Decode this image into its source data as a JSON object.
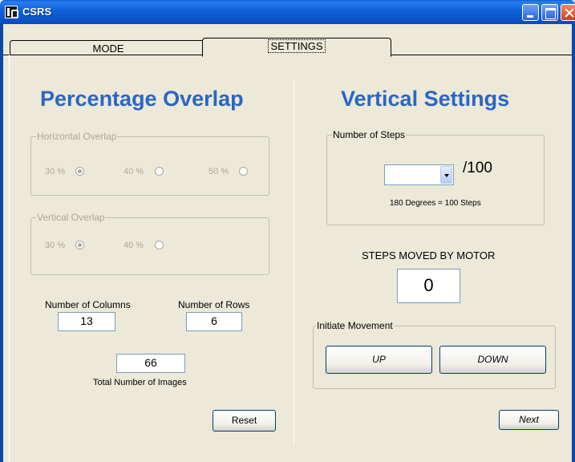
{
  "window": {
    "title": "CSRS"
  },
  "tabs": [
    {
      "label": "MODE"
    },
    {
      "label": "SETTINGS"
    }
  ],
  "overlap": {
    "heading": "Percentage Overlap",
    "horizontal": {
      "title": "Horizontal Overlap",
      "options": [
        "30 %",
        "40 %",
        "50 %"
      ],
      "selected": "30 %"
    },
    "vertical": {
      "title": "Vertical Overlap",
      "options": [
        "30 %",
        "40 %"
      ],
      "selected": "30 %"
    },
    "columns_label": "Number of Columns",
    "columns_value": "13",
    "rows_label": "Number of Rows",
    "rows_value": "6",
    "total_value": "66",
    "total_label": "Total Number of Images",
    "reset_label": "Reset"
  },
  "vertical_settings": {
    "heading": "Vertical Settings",
    "steps_group_title": "Number of Steps",
    "steps_selected": "",
    "steps_suffix": "/100",
    "steps_note": "180 Degrees = 100 Steps",
    "motor_label": "STEPS MOVED BY MOTOR",
    "motor_value": "0",
    "movement_group_title": "Initiate Movement",
    "up_label": "UP",
    "down_label": "DOWN",
    "next_label": "Next"
  }
}
